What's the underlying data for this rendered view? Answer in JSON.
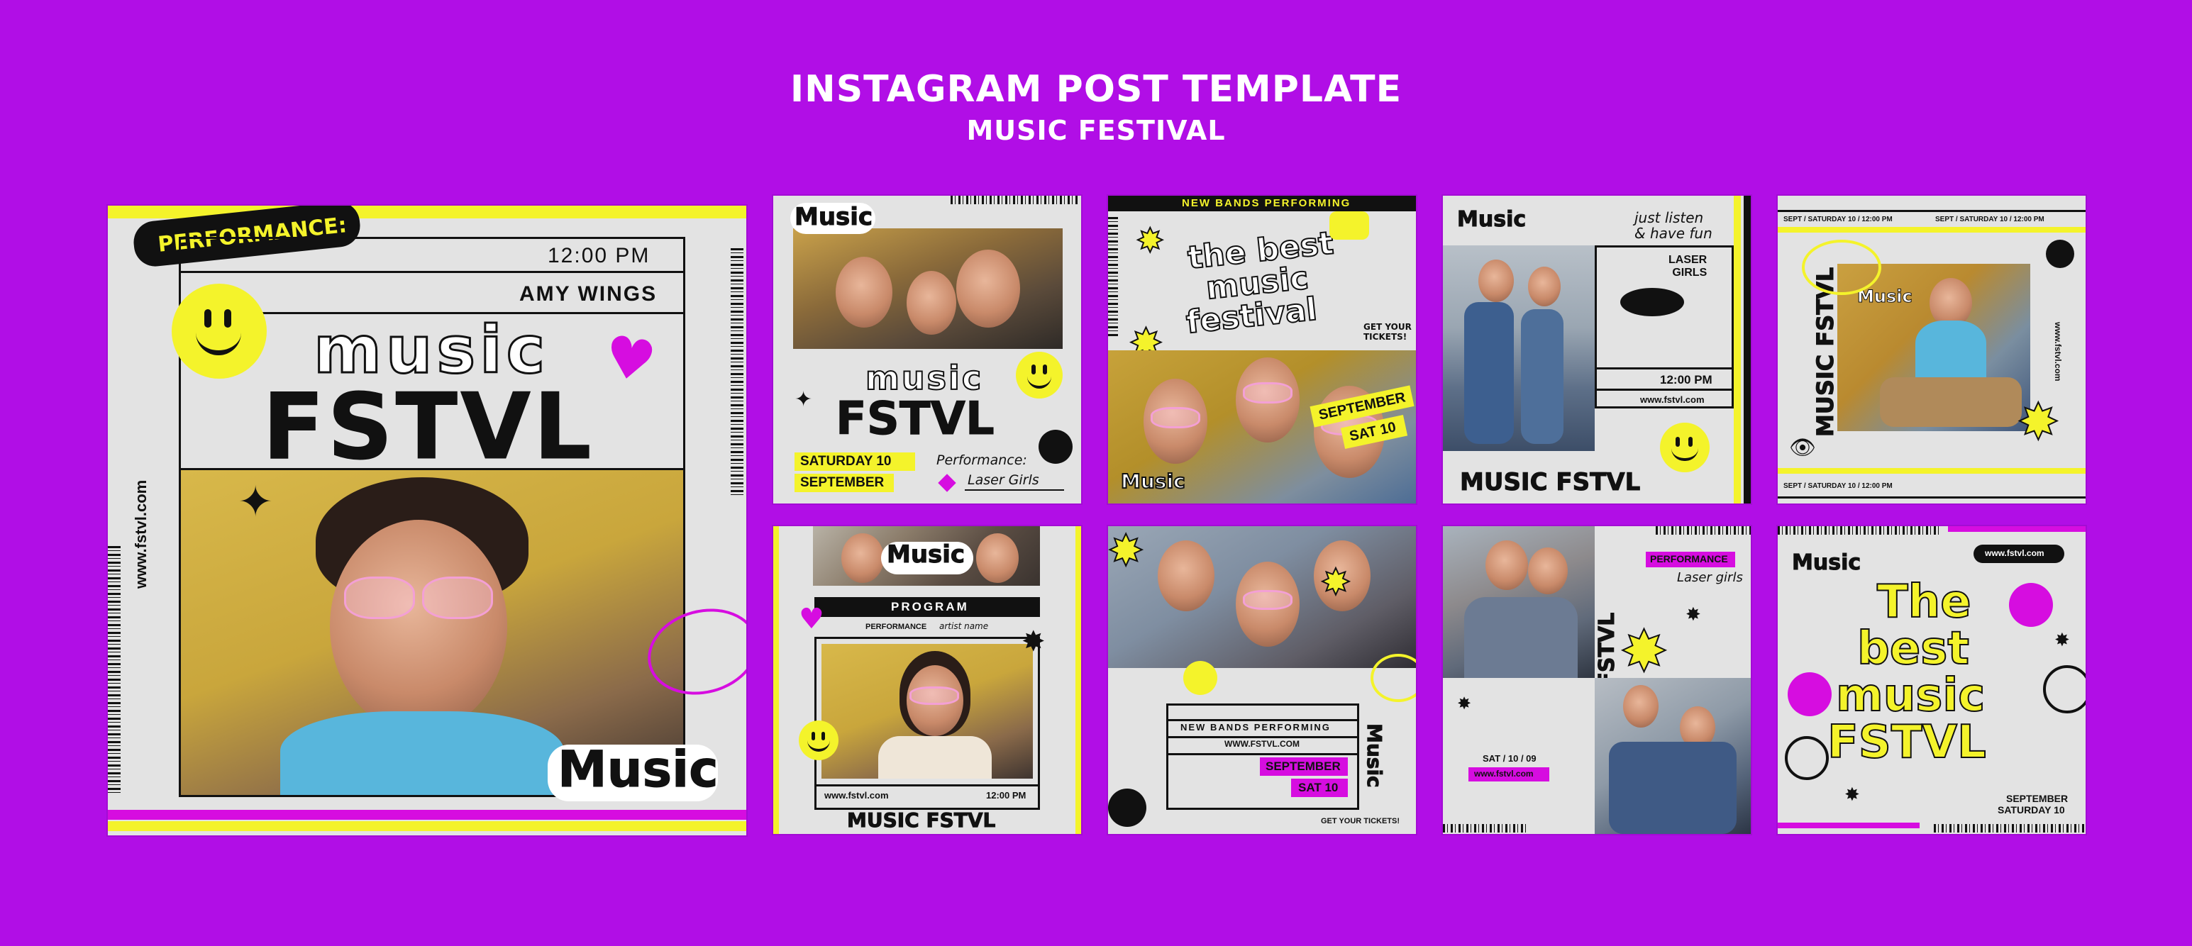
{
  "header": {
    "title": "INSTAGRAM POST TEMPLATE",
    "subtitle": "MUSIC FESTIVAL"
  },
  "post1": {
    "performance": "PERFORMANCE:",
    "time": "12:00 PM",
    "artist": "AMY WINGS",
    "music_word": "music",
    "fstvl_word": "FSTVL",
    "site": "www.fstvl.com",
    "sticker": "Music"
  },
  "post2": {
    "sticker": "Music",
    "music_word": "music",
    "fstvl_word": "FSTVL",
    "date_line1": "SATURDAY 10",
    "date_line2": "SEPTEMBER",
    "performance_label": "Performance:",
    "performer": "Laser Girls"
  },
  "post3": {
    "banner": "NEW BANDS  PERFORMING",
    "headline1": "the best",
    "headline2": "music",
    "headline3": "festival",
    "tickets": "GET YOUR\nTICKETS!",
    "date1": "SEPTEMBER",
    "date2": "SAT 10",
    "sticker": "Music"
  },
  "post4": {
    "sticker": "Music",
    "handwritten": "just listen\n& have fun",
    "laser": "LASER\nGIRLS",
    "time": "12:00 PM",
    "site": "www.fstvl.com",
    "footer": "MUSIC FSTVL"
  },
  "post5": {
    "strip": "SEPT / SATURDAY 10 / 12:00 PM",
    "strip2": "SEPT / SATURDAY 10 / 12:00 PM",
    "strip3": "SEPT / SATURDAY 10 / 12:00 PM",
    "vertical_title": "MUSIC FSTVL",
    "sticker": "Music",
    "site": "www.fstvl.com"
  },
  "post6": {
    "sticker": "Music",
    "program": "PROGRAM",
    "performance": "PERFORMANCE",
    "artist": "artist name",
    "site": "www.fstvl.com",
    "time": "12:00 PM",
    "footer": "MUSIC FSTVL"
  },
  "post7": {
    "banner": "NEW BANDS  PERFORMING",
    "site": "WWW.FSTVL.COM",
    "date1": "SEPTEMBER",
    "date2": "SAT 10",
    "vertical_sticker": "Music",
    "tickets": "GET YOUR TICKETS!"
  },
  "post8": {
    "performance": "PERFORMANCE",
    "performer": "Laser girls",
    "vertical_title": "MUSIC FSTVL",
    "date": "SAT / 10 / 09",
    "site": "www.fstvl.com"
  },
  "post9": {
    "sticker": "Music",
    "site": "www.fstvl.com",
    "headline1": "The",
    "headline2": "best",
    "headline3": "music",
    "headline4": "FSTVL",
    "date1": "SEPTEMBER",
    "date2": "SATURDAY 10"
  },
  "colors": {
    "background": "#b10ee6",
    "yellow": "#f4f32b",
    "magenta": "#d60de0",
    "card": "#e3e3e3",
    "ink": "#111111"
  }
}
